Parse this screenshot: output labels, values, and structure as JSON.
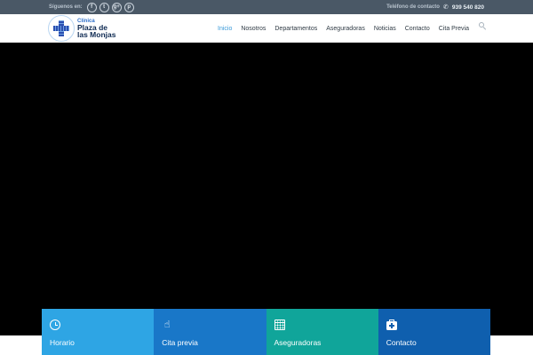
{
  "topbar": {
    "follow_label": "Síguenos en:",
    "social": [
      {
        "name": "facebook-icon",
        "glyph": "f"
      },
      {
        "name": "twitter-icon",
        "glyph": "t"
      },
      {
        "name": "google-plus-icon",
        "glyph": "g+"
      },
      {
        "name": "pinterest-icon",
        "glyph": "p"
      }
    ],
    "contact_label": "Teléfono de contacto",
    "phone": "939 540 820"
  },
  "logo": {
    "small": "Clínica",
    "line1": "Plaza de",
    "line2": "las Monjas"
  },
  "nav": {
    "items": [
      "Inicio",
      "Nosotros",
      "Departamentos",
      "Aseguradoras",
      "Noticias",
      "Contacto",
      "Cita Previa"
    ],
    "active_index": 0
  },
  "features": [
    {
      "label": "Horario",
      "icon": "clock-icon",
      "color": "#2ea5e4"
    },
    {
      "label": "Cita previa",
      "icon": "hand-icon",
      "color": "#1977c8"
    },
    {
      "label": "Aseguradoras",
      "icon": "calendar-icon",
      "color": "#10a59a"
    },
    {
      "label": "Contacto",
      "icon": "medkit-icon",
      "color": "#0f5fae"
    }
  ],
  "colors": {
    "topbar_bg": "#4a5866",
    "accent": "#3a9ad9",
    "hero_bg": "#000000"
  }
}
